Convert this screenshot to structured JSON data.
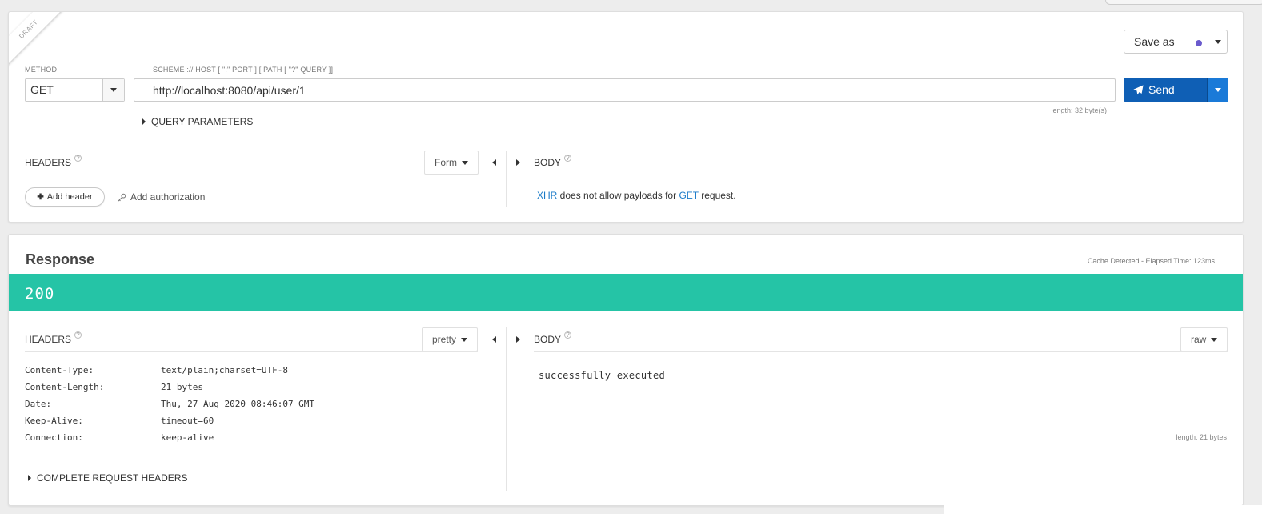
{
  "request": {
    "draft_label": "DRAFT",
    "method_label": "METHOD",
    "method_value": "GET",
    "url_label": "SCHEME :// HOST [ \":\" PORT ] [ PATH [ \"?\" QUERY ]]",
    "url_value": "http://localhost:8080/api/user/1",
    "url_length": "length: 32 byte(s)",
    "save_as_label": "Save as",
    "send_label": "Send",
    "query_params_label": "QUERY PARAMETERS",
    "headers_title": "HEADERS",
    "headers_mode": "Form",
    "add_header_label": "Add header",
    "add_auth_label": "Add authorization",
    "body_title": "BODY",
    "body_msg": {
      "xhr": "XHR",
      "mid": " does not allow payloads for ",
      "method": "GET",
      "end": " request."
    }
  },
  "response": {
    "title": "Response",
    "elapsed": "Cache Detected - Elapsed Time: 123ms",
    "status_code": "200",
    "status_color": "#25c4a6",
    "headers_title": "HEADERS",
    "headers_mode": "pretty",
    "headers": [
      {
        "key": "Content-Type:",
        "value": "text/plain;charset=UTF-8"
      },
      {
        "key": "Content-Length:",
        "value": "21 bytes"
      },
      {
        "key": "Date:",
        "value": "Thu, 27 Aug 2020 08:46:07 GMT"
      },
      {
        "key": "Keep-Alive:",
        "value": "timeout=60"
      },
      {
        "key": "Connection:",
        "value": "keep-alive"
      }
    ],
    "complete_headers_label": "COMPLETE REQUEST HEADERS",
    "body_title": "BODY",
    "body_mode": "raw",
    "body_text": "successfully executed",
    "body_length": "length: 21 bytes"
  },
  "colors": {
    "send_button": "#0f5fb5",
    "link": "#1a7ac8",
    "save_dot": "#6a5acd"
  },
  "icons": {
    "help": "?",
    "plus": "✚",
    "key": "key-icon",
    "send": "paper-plane-icon"
  }
}
